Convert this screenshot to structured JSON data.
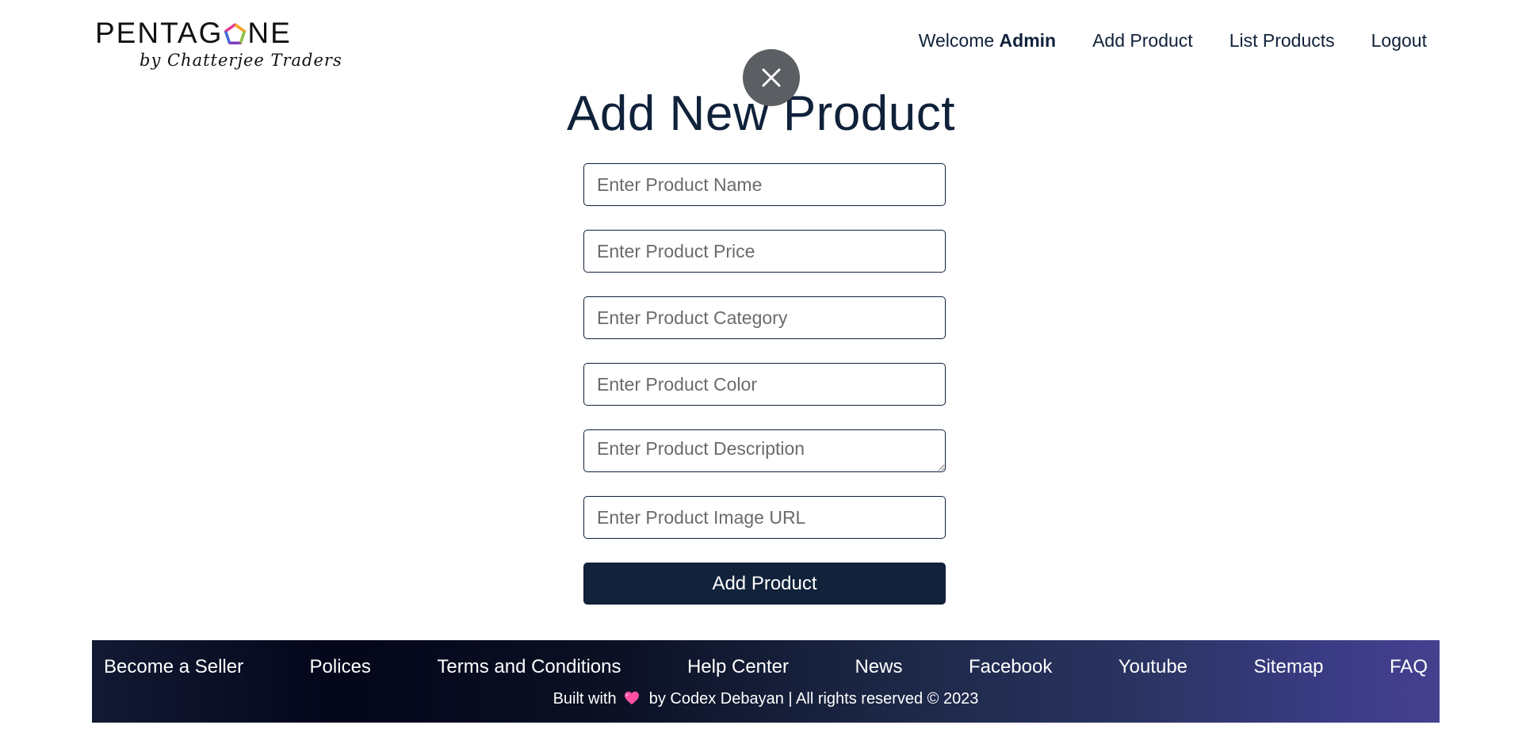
{
  "header": {
    "logo": {
      "word_left": "PENTAG",
      "word_right": "NE",
      "tagline": "by Chatterjee Traders"
    },
    "welcome_prefix": "Welcome",
    "welcome_user": "Admin",
    "nav": {
      "add_product": "Add Product",
      "list_products": "List Products",
      "logout": "Logout"
    }
  },
  "overlay": {
    "close_icon": "close-icon"
  },
  "form": {
    "title": "Add New Product",
    "fields": {
      "name_placeholder": "Enter Product Name",
      "price_placeholder": "Enter Product Price",
      "category_placeholder": "Enter Product Category",
      "color_placeholder": "Enter Product Color",
      "description_placeholder": "Enter Product Description",
      "image_url_placeholder": "Enter Product Image URL"
    },
    "submit_label": "Add Product"
  },
  "footer": {
    "links": [
      "Become a Seller",
      "Polices",
      "Terms and Conditions",
      "Help Center",
      "News",
      "Facebook",
      "Youtube",
      "Sitemap",
      "FAQ"
    ],
    "credit_prefix": "Built with",
    "credit_suffix": "by Codex Debayan | All rights reserved © 2023",
    "heart_icon": "heart-icon"
  },
  "colors": {
    "primary": "#10213a",
    "button_bg": "#11223a",
    "close_bg": "#5b5e62",
    "heart": "#ff4fa3",
    "footer_gradient_end": "#46408f"
  }
}
